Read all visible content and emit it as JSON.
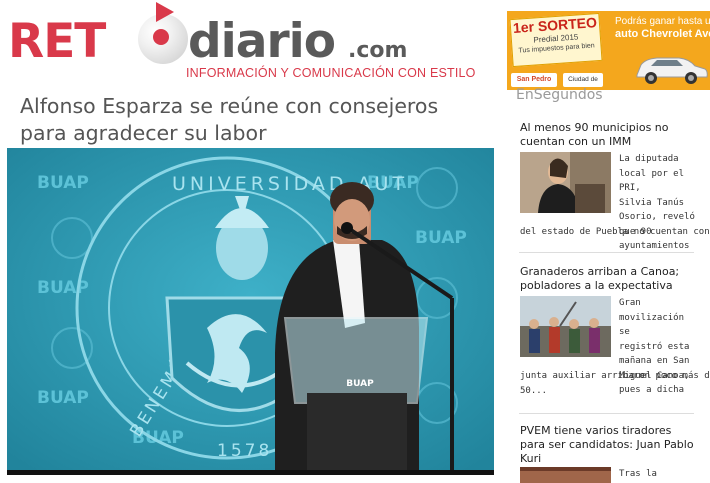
{
  "header": {
    "logo_ret": "RET",
    "logo_diario": "diario",
    "logo_com": ".com",
    "tagline": "INFORMACIÓN Y COMUNICACIÓN CON ESTILO"
  },
  "ad": {
    "badge_top": "1er SORTEO",
    "badge_mid": "Predial 2015",
    "badge_bottom": "Tus impuestos para bien",
    "line1": "Podrás ganar hasta un",
    "line2": "auto Chevrolet Aveo",
    "logo1": "San Pedro Cholula",
    "logo2": "Ciudad de Bien",
    "colors": {
      "background": "#f4a71d"
    }
  },
  "article": {
    "headline_line1": "Alfonso Esparza se reúne con consejeros",
    "headline_line2": "para agradecer su labor",
    "image": {
      "backdrop_words": [
        "BUAP",
        "BUAP",
        "BUAP",
        "BUAP",
        "BUAP",
        "BUAP"
      ],
      "seal_text": "UNIVERSIDAD AUT",
      "seal_left_text": "BENEMÉRITA",
      "seal_year": "1578",
      "podium_label": "BUAP",
      "colors": {
        "backdrop": "#2f9db6"
      }
    }
  },
  "sidebar": {
    "heading": "EnSegundos",
    "news": [
      {
        "title_line1": "Al menos 90 municipios no",
        "title_line2": "cuentan con un IMM",
        "excerpt": [
          "La diputada",
          "local por el PRI,",
          "Silvia Tanús",
          "Osorio, reveló",
          "que 90",
          "ayuntamientos"
        ],
        "excerpt_full": "del estado de Puebla no cuentan con..."
      },
      {
        "title_line1": "Granaderos arriban a Canoa;",
        "title_line2": "pobladores a la expectativa",
        "excerpt": [
          "Gran",
          "movilización se",
          "registró esta",
          "mañana en San",
          "Miguel Canoa,",
          "pues a dicha"
        ],
        "excerpt_full": "junta auxiliar arribaron poco más de",
        "excerpt_full2": "50..."
      },
      {
        "title_line1": "PVEM tiene varios tiradores",
        "title_line2": "para ser candidatos: Juan Pablo",
        "title_line3": "Kuri",
        "excerpt": [
          "Tras la alianza"
        ]
      }
    ]
  }
}
